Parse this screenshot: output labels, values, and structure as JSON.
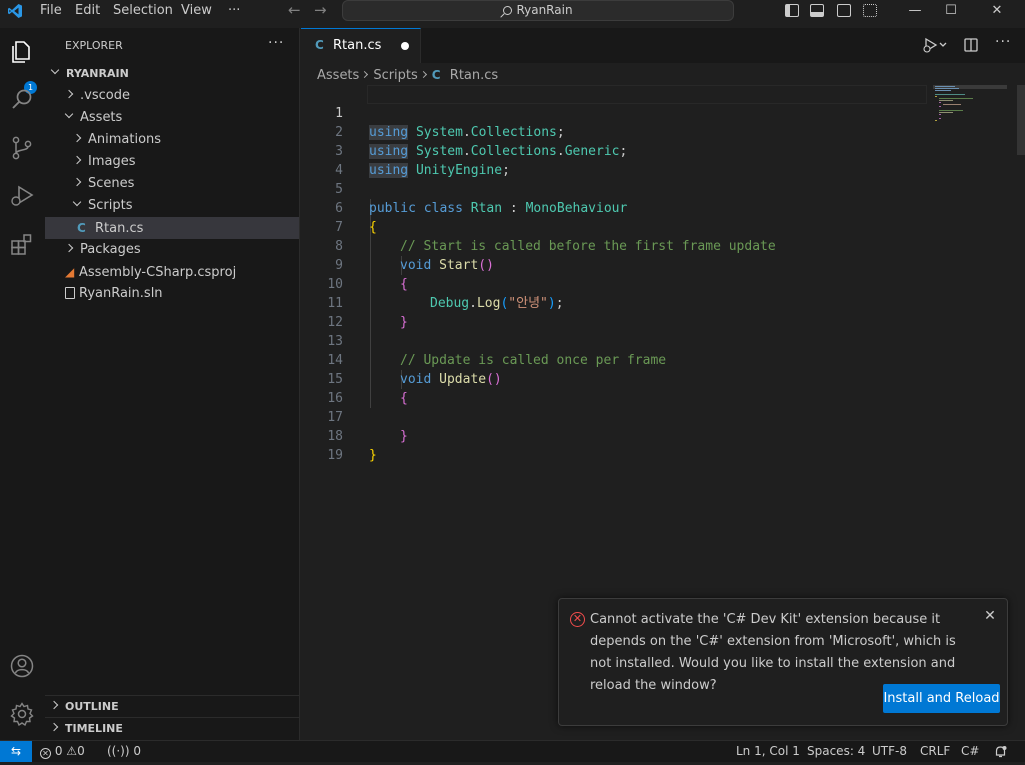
{
  "menu": [
    "File",
    "Edit",
    "Selection",
    "View",
    "···"
  ],
  "command_center": "RyanRain",
  "window_controls": [
    "—",
    "☐",
    "✕"
  ],
  "activity": {
    "explorer_badge": "1"
  },
  "sidebar": {
    "title": "EXPLORER",
    "more": "···",
    "root": "RYANRAIN",
    "items": [
      {
        "label": ".vscode"
      },
      {
        "label": "Assets"
      },
      {
        "label": "Animations"
      },
      {
        "label": "Images"
      },
      {
        "label": "Scenes"
      },
      {
        "label": "Scripts"
      },
      {
        "label": "Rtan.cs"
      },
      {
        "label": "Packages"
      },
      {
        "label": "Assembly-CSharp.csproj"
      },
      {
        "label": "RyanRain.sln"
      }
    ],
    "outline": "OUTLINE",
    "timeline": "TIMELINE"
  },
  "editor": {
    "tab": {
      "label": "Rtan.cs",
      "icon": "C"
    },
    "breadcrumb": [
      "Assets",
      "Scripts",
      "Rtan.cs"
    ],
    "line_numbers": [
      "1",
      "2",
      "3",
      "4",
      "5",
      "6",
      "7",
      "8",
      "9",
      "10",
      "11",
      "12",
      "13",
      "14",
      "15",
      "16",
      "17",
      "18",
      "19"
    ],
    "code": {
      "l1": [
        "using",
        " ",
        "System",
        ".",
        "Collections",
        ";"
      ],
      "l2": [
        "using",
        " ",
        "System",
        ".",
        "Collections",
        ".",
        "Generic",
        ";"
      ],
      "l3": [
        "using",
        " ",
        "UnityEngine",
        ";"
      ],
      "l5": [
        "public",
        " ",
        "class",
        " ",
        "Rtan",
        " : ",
        "MonoBehaviour"
      ],
      "l6": [
        "{"
      ],
      "l7": [
        "// Start is called before the first frame update"
      ],
      "l8": [
        "void",
        " ",
        "Start",
        "()"
      ],
      "l9": [
        "{"
      ],
      "l10": [
        "Debug",
        ".",
        "Log",
        "(",
        "\"안녕\"",
        ")",
        ";"
      ],
      "l11": [
        "}"
      ],
      "l13": [
        "// Update is called once per frame"
      ],
      "l14": [
        "void",
        " ",
        "Update",
        "()"
      ],
      "l15": [
        "{"
      ],
      "l17": [
        "}"
      ],
      "l18": [
        "}"
      ]
    }
  },
  "notification": {
    "message": "Cannot activate the 'C# Dev Kit' extension because it depends on the 'C#' extension from 'Microsoft', which is not installed. Would you like to install the extension and reload the window?",
    "button": "Install and Reload",
    "close": "✕"
  },
  "statusbar": {
    "remote": "⇆",
    "errors": "0",
    "warnings": "0",
    "ports": "0",
    "position": "Ln 1, Col 1",
    "spaces": "Spaces: 4",
    "encoding": "UTF-8",
    "eol": "CRLF",
    "language": "C#"
  },
  "colors": {
    "accent": "#0078d4",
    "error": "#f14c4c"
  }
}
